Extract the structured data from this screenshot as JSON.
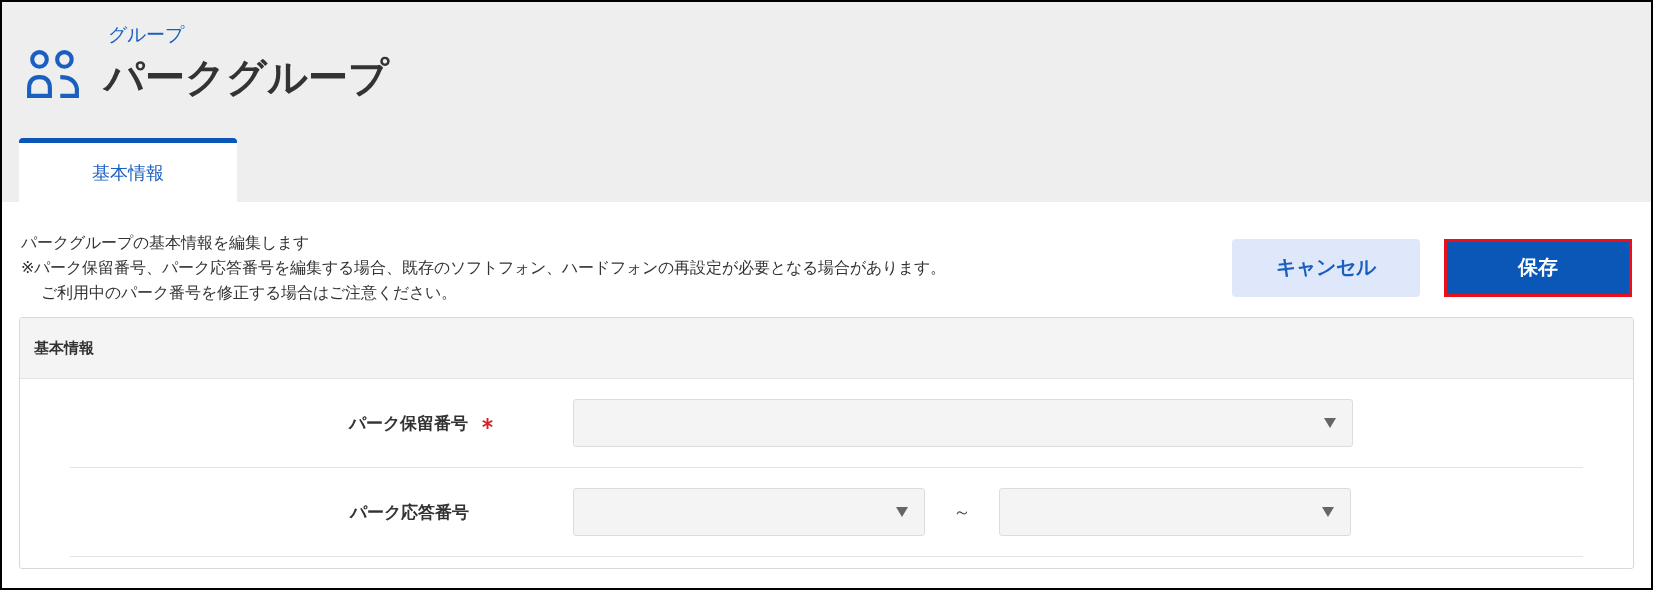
{
  "header": {
    "breadcrumb": "グループ",
    "title": "パークグループ"
  },
  "tabs": [
    {
      "label": "基本情報",
      "selected": true
    }
  ],
  "description": [
    {
      "text": "パークグループの基本情報を編集します",
      "indent": false
    },
    {
      "text": "※パーク保留番号、パーク応答番号を編集する場合、既存のソフトフォン、ハードフォンの再設定が必要となる場合があります。",
      "indent": false
    },
    {
      "text": "ご利用中のパーク番号を修正する場合はご注意ください。",
      "indent": true
    }
  ],
  "buttons": [
    {
      "label": "キャンセル",
      "kind": "secondary",
      "highlighted": false
    },
    {
      "label": "保存",
      "kind": "primary",
      "highlighted": true
    }
  ],
  "panel": {
    "title": "基本情報",
    "rows": [
      {
        "label": "パーク保留番号",
        "required": true,
        "kind": "single"
      },
      {
        "label": "パーク応答番号",
        "required": false,
        "kind": "range",
        "separator": "～"
      }
    ]
  }
}
